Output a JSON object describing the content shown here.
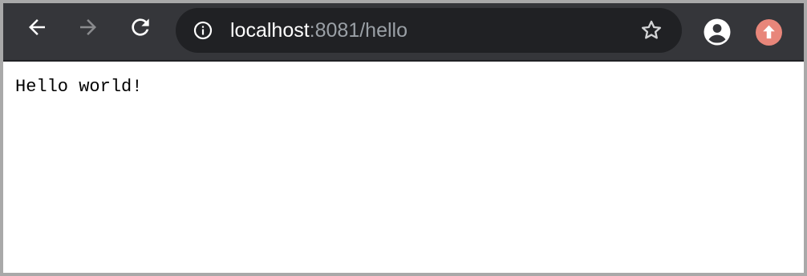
{
  "browser": {
    "address_bar": {
      "url_host": "localhost",
      "url_rest": ":8081/hello"
    },
    "icons": {
      "back": "arrow-left",
      "forward": "arrow-right",
      "reload": "refresh",
      "site_info": "info-circle",
      "bookmark": "star-outline",
      "account": "account-circle",
      "update": "arrow-up-circle"
    },
    "colors": {
      "toolbar": "#35363a",
      "omnibox": "#202124",
      "update_badge": "#e8867a"
    }
  },
  "page": {
    "text": "Hello world!"
  }
}
